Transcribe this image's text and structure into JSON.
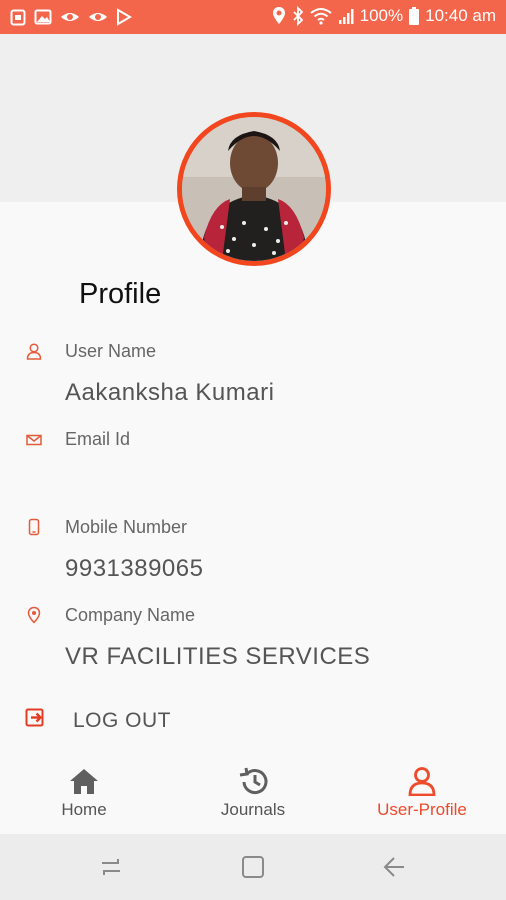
{
  "status_bar": {
    "battery": "100%",
    "time": "10:40 am",
    "left_icons": [
      "clipboard-icon",
      "image-icon",
      "eye-icon",
      "eye-icon",
      "play-store-icon"
    ],
    "right_icons": [
      "location-icon",
      "bluetooth-icon",
      "wifi-icon",
      "signal-icon",
      "battery-icon"
    ]
  },
  "profile": {
    "title": "Profile",
    "fields": [
      {
        "label": "User Name",
        "value": "Aakanksha Kumari",
        "icon": "user-icon"
      },
      {
        "label": "Email Id",
        "value": "",
        "icon": "mail-icon"
      },
      {
        "label": "Mobile Number",
        "value": "9931389065",
        "icon": "phone-icon"
      },
      {
        "label": "Company Name",
        "value": "VR FACILITIES SERVICES",
        "icon": "location-pin-icon"
      }
    ],
    "logout_label": "LOG OUT"
  },
  "bottom_nav": {
    "items": [
      {
        "label": "Home",
        "icon": "home-icon",
        "active": false
      },
      {
        "label": "Journals",
        "icon": "history-icon",
        "active": false
      },
      {
        "label": "User-Profile",
        "icon": "user-icon",
        "active": true
      }
    ]
  },
  "colors": {
    "accent": "#ee4a2b",
    "status_bar": "#f4664c",
    "avatar_ring": "#f2461f"
  }
}
